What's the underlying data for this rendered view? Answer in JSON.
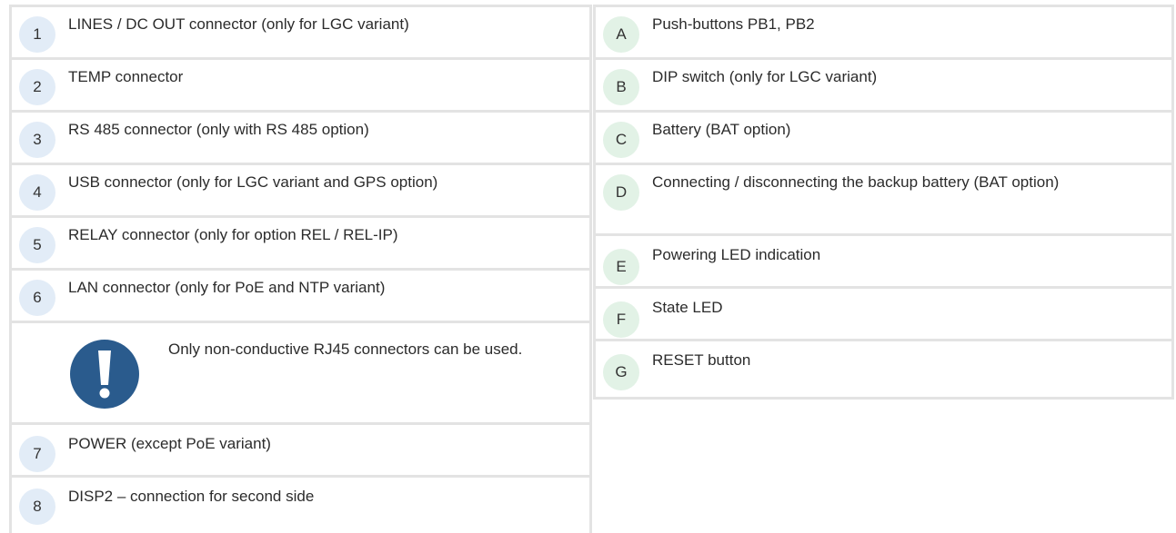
{
  "left_items": [
    {
      "marker": "1",
      "label": "LINES / DC OUT connector (only for LGC variant)"
    },
    {
      "marker": "2",
      "label": "TEMP connector"
    },
    {
      "marker": "3",
      "label": "RS 485 connector (only with RS 485 option)"
    },
    {
      "marker": "4",
      "label": "USB connector (only for LGC variant and GPS option)"
    },
    {
      "marker": "5",
      "label": "RELAY connector (only for option REL / REL-IP)"
    },
    {
      "marker": "6",
      "label": "LAN connector (only for PoE and NTP variant)"
    },
    {
      "marker": "7",
      "label": "POWER (except PoE variant)"
    },
    {
      "marker": "8",
      "label": "DISP2 – connection for second side"
    }
  ],
  "note": {
    "icon": "exclamation-icon",
    "color": "#2a5b8d",
    "text": "Only non-conductive RJ45 connectors can be used."
  },
  "right_items": [
    {
      "marker": "A",
      "label": "Push-buttons PB1, PB2"
    },
    {
      "marker": "B",
      "label": "DIP switch (only for LGC variant)"
    },
    {
      "marker": "C",
      "label": "Battery (BAT option)"
    },
    {
      "marker": "D",
      "label": "Connecting / disconnecting the backup battery (BAT option)"
    },
    {
      "marker": "E",
      "label": "Powering LED indication"
    },
    {
      "marker": "F",
      "label": "State LED"
    },
    {
      "marker": "G",
      "label": "RESET button"
    }
  ]
}
